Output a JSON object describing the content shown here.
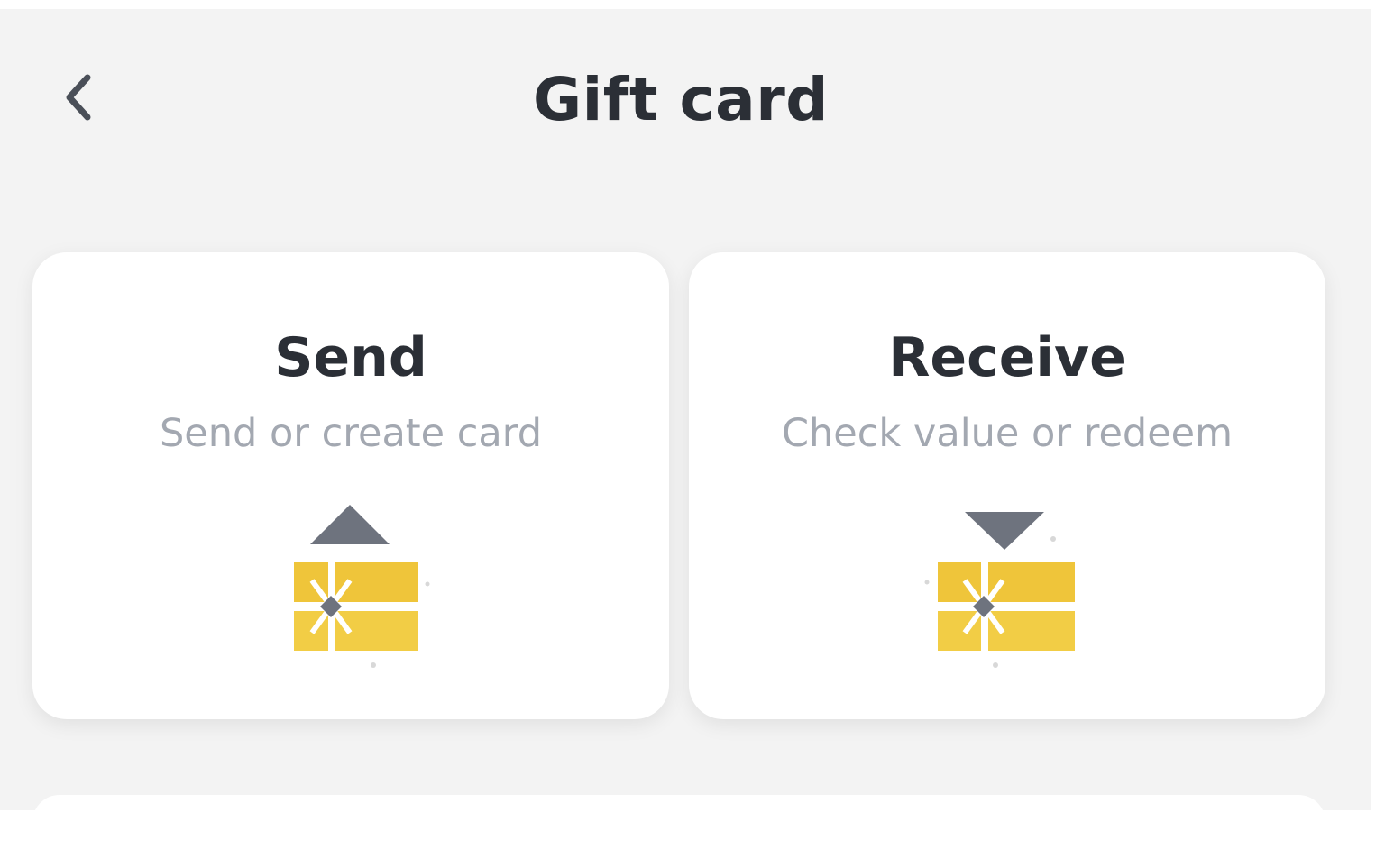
{
  "header": {
    "title": "Gift card",
    "back_icon": "chevron-left-icon"
  },
  "cards": {
    "send": {
      "title": "Send",
      "subtitle": "Send or create card",
      "icon": "gift-send-icon"
    },
    "receive": {
      "title": "Receive",
      "subtitle": "Check value or redeem",
      "icon": "gift-receive-icon"
    }
  },
  "colors": {
    "background": "#f3f3f3",
    "card": "#ffffff",
    "title_text": "#2b2f36",
    "subtitle_text": "#a3a8b1",
    "gift_yellow": "#f0c93a",
    "arrow_gray": "#6e737e"
  }
}
